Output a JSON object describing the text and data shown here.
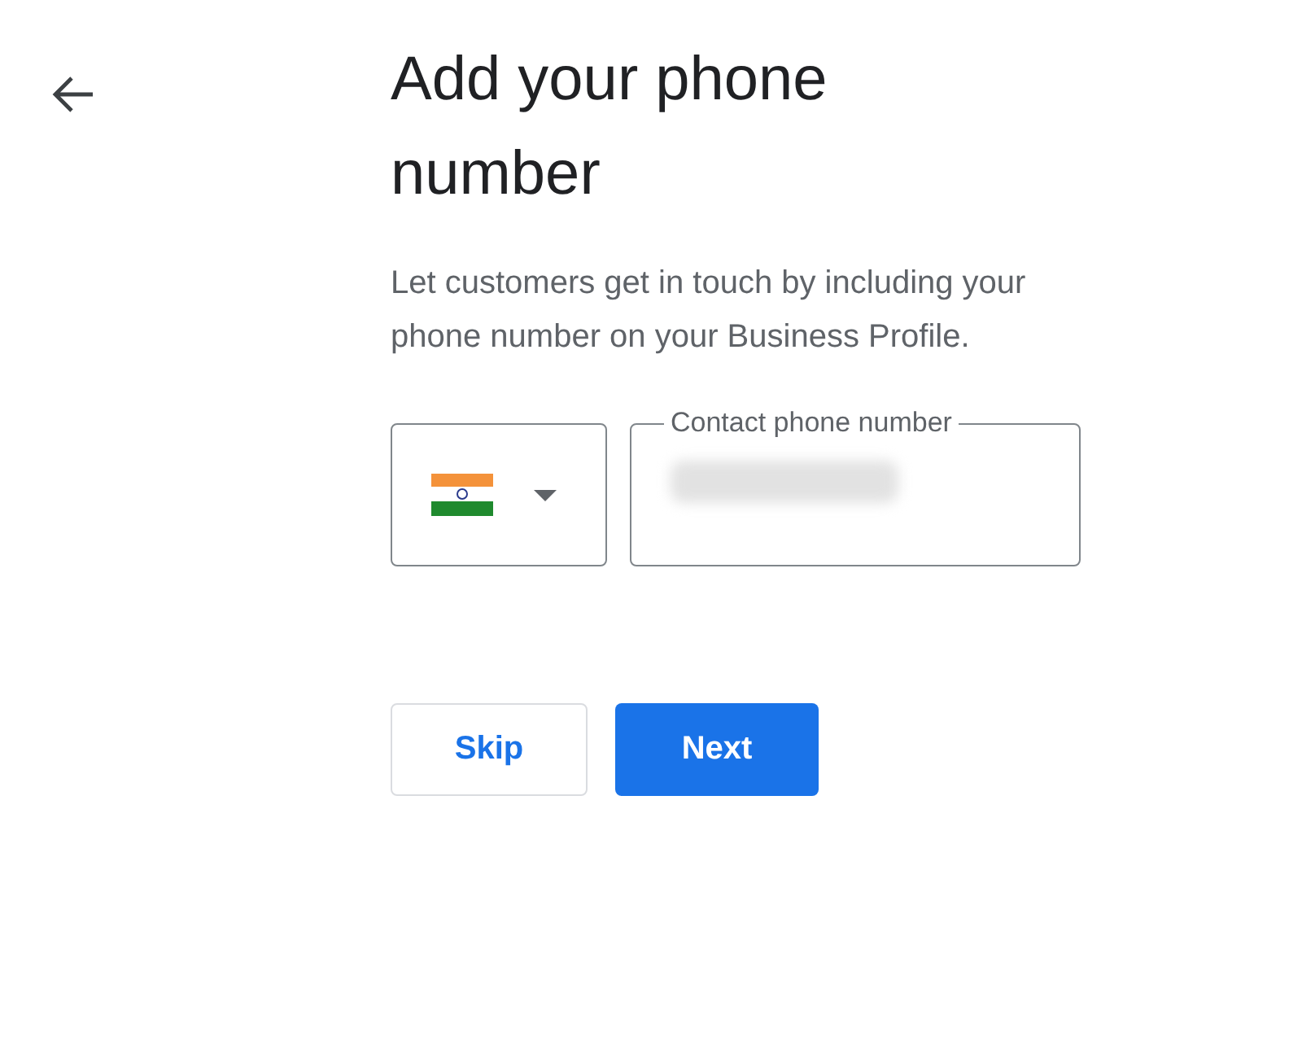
{
  "title": "Add your phone number",
  "description": "Let customers get in touch by including your phone number on your Business Profile.",
  "phone_field": {
    "label": "Contact phone number",
    "redacted": true
  },
  "buttons": [
    {
      "label": "Skip",
      "kind": "secondary"
    },
    {
      "label": "Next",
      "kind": "primary"
    }
  ]
}
